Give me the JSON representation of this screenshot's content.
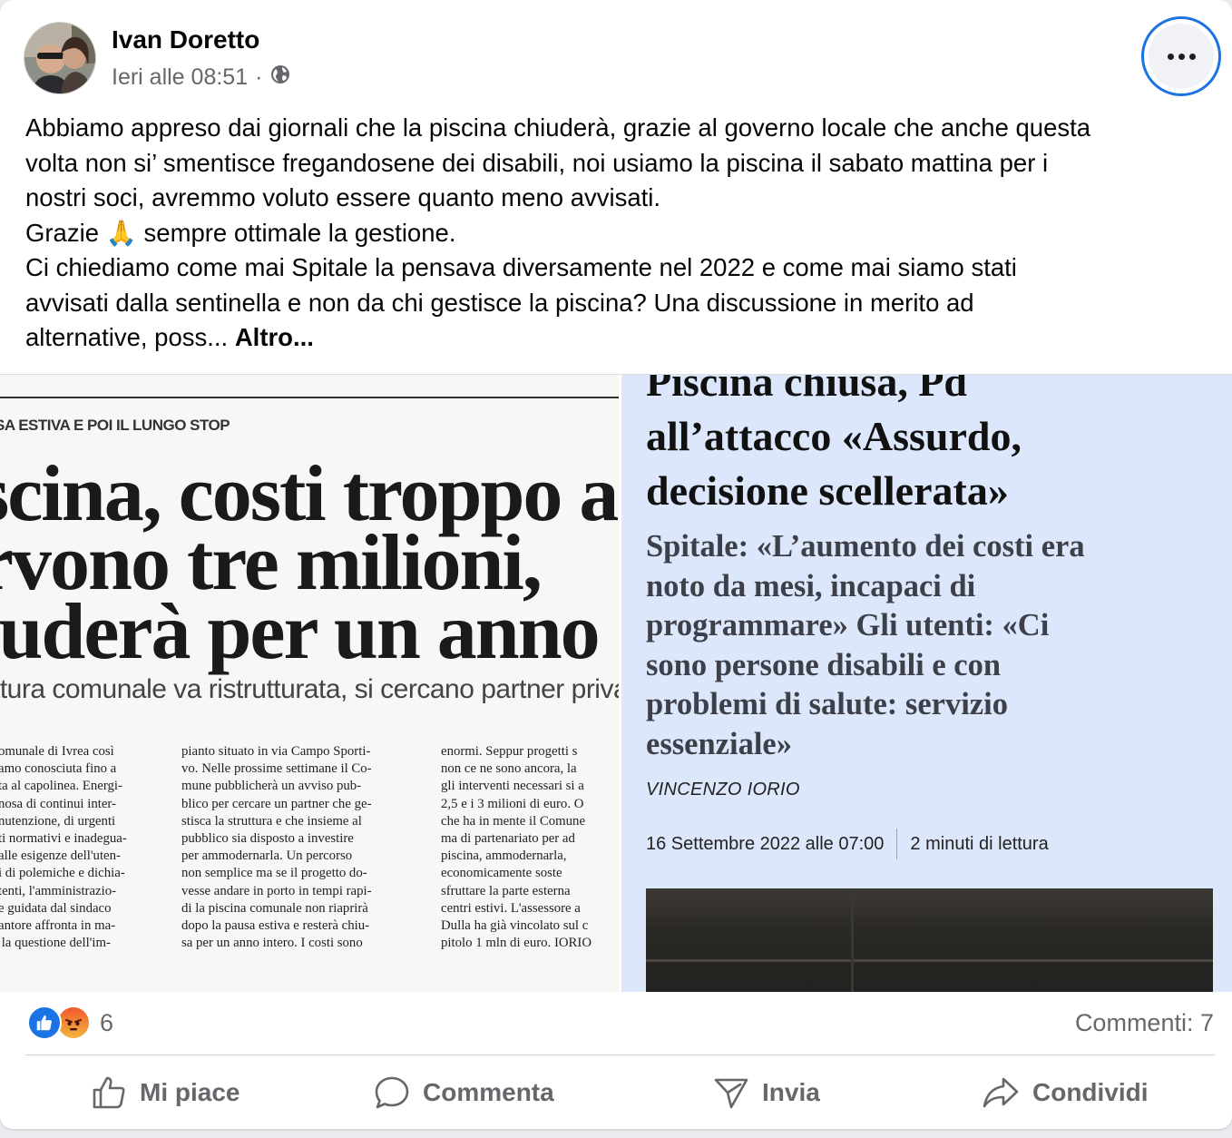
{
  "post": {
    "author": "Ivan Doretto",
    "timestamp": "Ieri alle 08:51",
    "separator": "·",
    "privacy_icon": "globe-icon",
    "text_lines": [
      "Abbiamo appreso dai giornali che la piscina chiuderà, grazie al governo locale che anche questa",
      "volta non si’ smentisce fregandosene dei disabili, noi usiamo la piscina il sabato mattina per i",
      "nostri soci, avremmo voluto essere quanto meno avvisati."
    ],
    "thanks_word": "Grazie",
    "thanks_emoji": "🙏",
    "thanks_rest": "sempre ottimale la gestione.",
    "text_lines_2": [
      "Ci chiediamo come mai Spitale la pensava diversamente nel 2022 e come mai siamo stati",
      "avvisati dalla sentinella e non da chi gestisce la piscina? Una discussione in merito ad"
    ],
    "last_line": "alternative, poss...",
    "see_more": "Altro..."
  },
  "clip_left": {
    "kicker": "SA ESTIVA E POI IL LUNGO STOP",
    "headline": [
      "scina, costi troppo a",
      "rvono tre milioni,",
      "iuderà per un anno"
    ],
    "subhead": "ttura comunale va ristrutturata, si cercano partner privati",
    "col1": "omunale di Ivrea così\namo conosciuta fino a\nta al capolinea. Energi-\nnosa di continui inter-\nnutenzione, di urgenti\nti normativi e inadegua-\nalle esigenze dell'uten-\ni di polemiche e dichia-\ntenti, l'amministrazio-\ne guidata dal sindaco\nantore affronta in ma-\n la questione dell'im-",
    "col2": "pianto situato in via Campo Sporti-\nvo. Nelle prossime settimane il Co-\nmune pubblicherà un avviso pub-\nblico per cercare un partner che ge-\nstisca la struttura e che insieme al\npubblico sia disposto a investire\nper ammodernarla. Un percorso\nnon semplice ma se il progetto do-\nvesse andare in porto in tempi rapi-\ndi la piscina comunale non riaprirà\ndopo la pausa estiva e resterà chiu-\nsa per un anno intero. I costi sono",
    "col3": "enormi. Seppur progetti s\nnon ce ne sono ancora, la\ngli interventi necessari si a\n2,5 e i 3 milioni di euro. O\nche ha in mente il Comune\nma di partenariato per ad\npiscina, ammodernarla,\neconomicamente soste\nsfruttare la parte esterna\ncentri estivi. L'assessore a\nDulla ha già vincolato sul c\npitolo 1 mln di euro. IORIO"
  },
  "clip_right": {
    "title": "Piscina chiusa, Pd\nall’attacco «Assurdo,\ndecisione scellerata»",
    "subtitle": "Spitale: «L’aumento dei costi era\nnoto da mesi, incapaci di\nprogrammare» Gli utenti: «Ci\nsono persone disabili e con\nproblemi di salute: servizio\nessenziale»",
    "byline": "VINCENZO IORIO",
    "date": "16 Settembre 2022 alle 07:00",
    "read_time": "2 minuti di lettura"
  },
  "reactions": {
    "count": "6",
    "types": [
      "like-icon",
      "angry-icon"
    ],
    "comments": "Commenti: 7"
  },
  "actions": {
    "like": "Mi piace",
    "comment": "Commenta",
    "send": "Invia",
    "share": "Condividi"
  },
  "colors": {
    "accent": "#1b74e4",
    "secondary_text": "#65676b",
    "article_bg": "#dce7fb"
  }
}
